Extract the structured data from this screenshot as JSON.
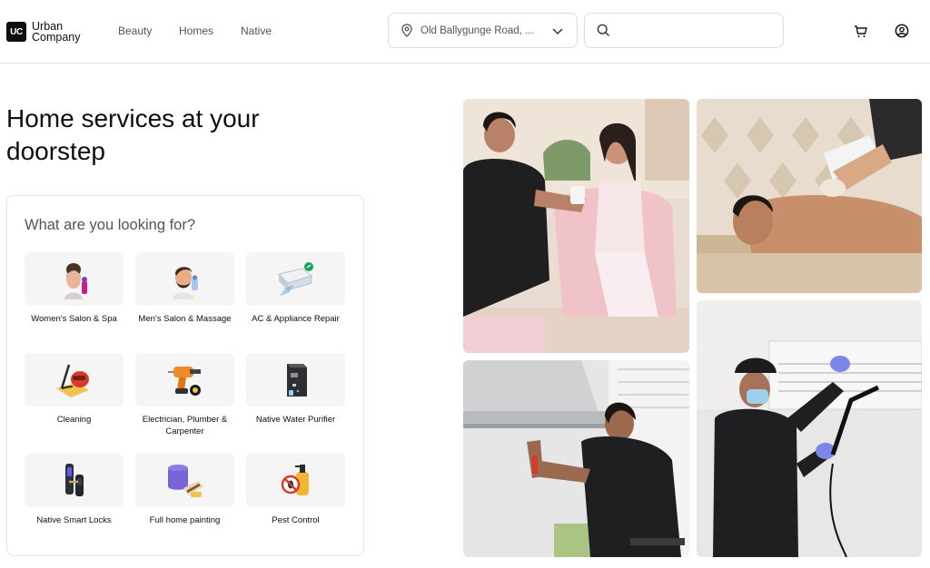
{
  "header": {
    "logo_mark": "UC",
    "logo_line1": "Urban",
    "logo_line2": "Company",
    "nav": [
      "Beauty",
      "Homes",
      "Native"
    ],
    "location": "Old Ballygunge Road, ...",
    "search_placeholder": ""
  },
  "hero": {
    "title": "Home services at your doorstep"
  },
  "services": {
    "heading": "What are you looking for?",
    "items": [
      {
        "label": "Women's Salon & Spa",
        "icon": "women-salon-icon"
      },
      {
        "label": "Men's Salon & Massage",
        "icon": "men-salon-icon"
      },
      {
        "label": "AC & Appliance Repair",
        "icon": "ac-repair-icon"
      },
      {
        "label": "Cleaning",
        "icon": "vacuum-cleaner-icon"
      },
      {
        "label": "Electrician, Plumber & Carpenter",
        "icon": "drill-icon"
      },
      {
        "label": "Native Water Purifier",
        "icon": "water-purifier-icon"
      },
      {
        "label": "Native Smart Locks",
        "icon": "smart-lock-icon"
      },
      {
        "label": "Full home painting",
        "icon": "paint-bucket-icon"
      },
      {
        "label": "Pest Control",
        "icon": "pest-spray-icon"
      }
    ]
  },
  "colors": {
    "brand_black": "#0f0f0f",
    "border": "#e3e3e3",
    "tile_bg": "#f5f5f5",
    "muted_text": "#545454"
  }
}
